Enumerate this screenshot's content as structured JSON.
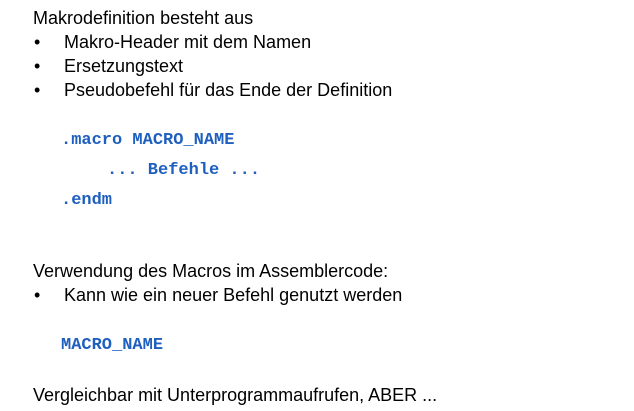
{
  "section1": {
    "heading": "Makrodefinition besteht aus",
    "bullets": [
      "Makro-Header mit dem Namen",
      "Ersetzungstext",
      "Pseudobefehl für das Ende der Definition"
    ]
  },
  "code1": {
    "line1": ".macro MACRO_NAME",
    "line2": "... Befehle ...",
    "line3": ".endm"
  },
  "section2": {
    "heading": "Verwendung des Macros im Assemblercode:",
    "bullets": [
      "Kann wie ein neuer Befehl genutzt werden"
    ]
  },
  "code2": {
    "line1": "MACRO_NAME"
  },
  "footer": {
    "text": "Vergleichbar mit Unterprogrammaufrufen, ABER ..."
  },
  "bullet_glyph": "•",
  "colors": {
    "code": "#1f5fbf",
    "text": "#000000"
  }
}
